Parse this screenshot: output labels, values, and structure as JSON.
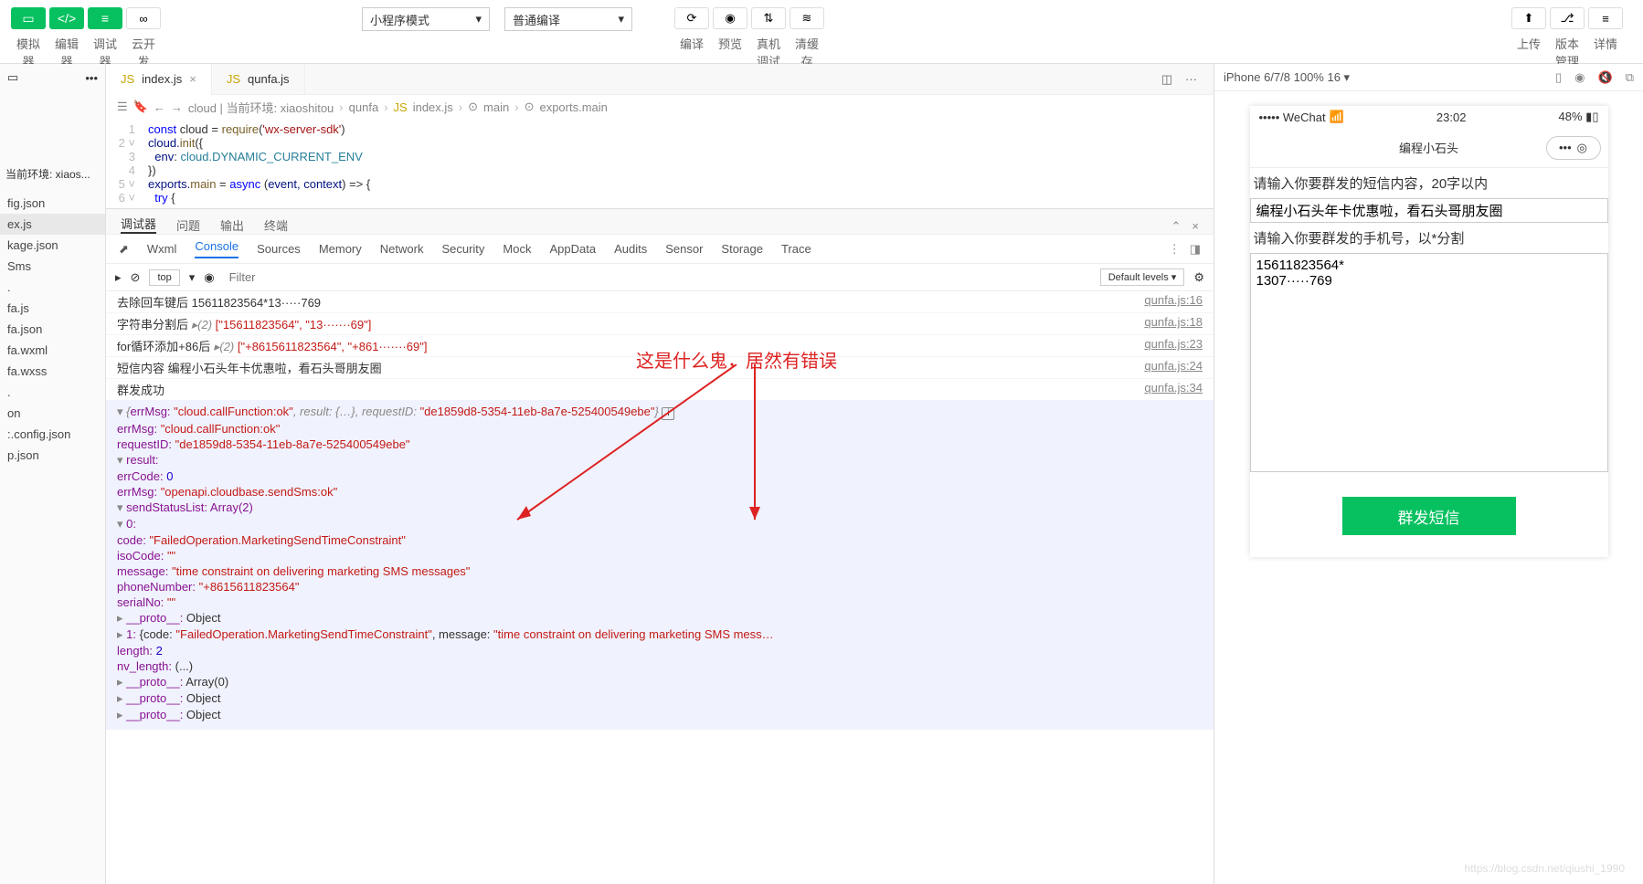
{
  "toolbar": {
    "simulator": "模拟器",
    "editor": "编辑器",
    "debugger": "调试器",
    "cloud": "云开发",
    "mode": "小程序模式",
    "compile_mode": "普通编译",
    "compile": "编译",
    "preview": "预览",
    "remote_debug": "真机调试",
    "clear_cache": "清缓存",
    "upload": "上传",
    "version": "版本管理",
    "details": "详情"
  },
  "sidebar": {
    "menu_dots": "•••",
    "env_label": "当前环境: xiaos...",
    "files": [
      "fig.json",
      "ex.js",
      "kage.json",
      "Sms",
      ".",
      "fa.js",
      "fa.json",
      "fa.wxml",
      "fa.wxss",
      ".",
      "on",
      ":.config.json",
      "p.json"
    ]
  },
  "tabs": [
    {
      "icon": "JS",
      "name": "index.js",
      "active": true
    },
    {
      "icon": "JS",
      "name": "qunfa.js",
      "active": false
    }
  ],
  "breadcrumb": [
    "cloud | 当前环境: xiaoshitou",
    "qunfa",
    "index.js",
    "main",
    "exports.main"
  ],
  "code": {
    "l1": {
      "kw": "const",
      "var": " cloud ",
      "op": "= ",
      "fn": "require",
      "paren": "(",
      "str": "'wx-server-sdk'",
      "end": ")"
    },
    "l2": {
      "obj": "cloud.",
      "fn": "init",
      "paren": "({"
    },
    "l3": {
      "key": "env",
      "colon": ": ",
      "val": "cloud.DYNAMIC_CURRENT_ENV"
    },
    "l4": {
      "txt": "})"
    },
    "l5": {
      "obj": "exports.",
      "fn": "main",
      "op": " = ",
      "kw": "async ",
      "paren": "(",
      "args": "event, context",
      "end": ") => {"
    }
  },
  "panel": {
    "tabs": [
      "调试器",
      "问题",
      "输出",
      "终端"
    ],
    "devtools": [
      "Wxml",
      "Console",
      "Sources",
      "Memory",
      "Network",
      "Security",
      "Mock",
      "AppData",
      "Audits",
      "Sensor",
      "Storage",
      "Trace"
    ],
    "filter_top": "top",
    "filter_placeholder": "Filter",
    "levels": "Default levels ▾"
  },
  "console": {
    "logs": [
      {
        "pre": "去除回车键后 15611823564*13·····769",
        "src": "qunfa.js:16"
      },
      {
        "pre": "字符串分割后 ",
        "expand": "▸(2) ",
        "array": "[\"15611823564\", \"13·······69\"]",
        "src": "qunfa.js:18"
      },
      {
        "pre": "for循环添加+86后 ",
        "expand": "▸(2) ",
        "array": "[\"+8615611823564\", \"+861·······69\"]",
        "src": "qunfa.js:23"
      },
      {
        "pre": "短信内容 编程小石头年卡优惠啦，看石头哥朋友圈",
        "src": "qunfa.js:24"
      },
      {
        "pre": "群发成功",
        "src": "qunfa.js:34"
      }
    ],
    "obj_header": {
      "errMsg": "errMsg:",
      "errMsg_v": "\"cloud.callFunction:ok\"",
      "result": ", result:",
      "result_v": " {…}",
      "reqid": ", requestID:",
      "reqid_v": "\"de1859d8-5354-11eb-8a7e-525400549ebe\""
    },
    "obj": {
      "errMsg_k": "errMsg:",
      "errMsg_v": "\"cloud.callFunction:ok\"",
      "reqid_k": "requestID:",
      "reqid_v": "\"de1859d8-5354-11eb-8a7e-525400549ebe\"",
      "result_k": "result:",
      "errCode_k": "errCode:",
      "errCode_v": "0",
      "errMsg2_k": "errMsg:",
      "errMsg2_v": "\"openapi.cloudbase.sendSms:ok\"",
      "ssl_k": "sendStatusList: Array(2)",
      "idx0": "0:",
      "code_k": "code:",
      "code_v": "\"FailedOperation.MarketingSendTimeConstraint\"",
      "iso_k": "isoCode:",
      "iso_v": "\"\"",
      "msg_k": "message:",
      "msg_v": "\"time constraint on delivering marketing SMS messages\"",
      "phone_k": "phoneNumber:",
      "phone_v": "\"+8615611823564\"",
      "serial_k": "serialNo:",
      "serial_v": "\"\"",
      "proto_k": "__proto__: ",
      "proto_v": "Object",
      "idx1": "1: ",
      "idx1_code": "{code:",
      "idx1_code_v": "\"FailedOperation.MarketingSendTimeConstraint\"",
      "idx1_msg": ", message:",
      "idx1_msg_v": "\"time constraint on delivering marketing SMS mess…",
      "len_k": "length:",
      "len_v": "2",
      "nvlen_k": "nv_length:",
      "nvlen_v": "(...)",
      "proto_arr": "Array(0)"
    },
    "annotation": "这是什么鬼，居然有错误"
  },
  "simulator": {
    "device": "iPhone 6/7/8 100% 16 ▾",
    "status_left": "••••• WeChat",
    "wifi": "📶",
    "time": "23:02",
    "battery": "48% ▮▯",
    "title": "编程小石头",
    "label1": "请输入你要群发的短信内容，20字以内",
    "input1": "编程小石头年卡优惠啦，看石头哥朋友圈",
    "label2": "请输入你要群发的手机号，以*分割",
    "textarea": "15611823564*\n1307·····769",
    "button": "群发短信",
    "watermark": "https://blog.csdn.net/qiushi_1990"
  }
}
